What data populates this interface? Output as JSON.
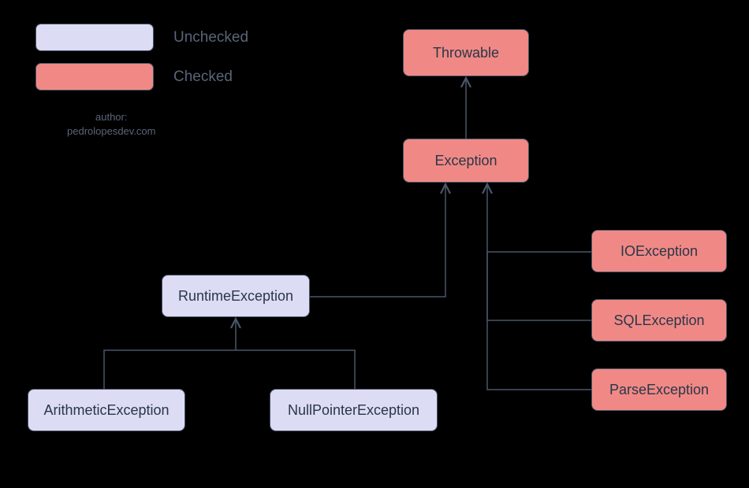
{
  "legend": {
    "unchecked_label": "Unchecked",
    "checked_label": "Checked"
  },
  "author": {
    "line1": "author:",
    "line2": "pedrolopesdev.com"
  },
  "nodes": {
    "throwable": "Throwable",
    "exception": "Exception",
    "runtime_exception": "RuntimeException",
    "arithmetic_exception": "ArithmeticException",
    "nullpointer_exception": "NullPointerException",
    "io_exception": "IOException",
    "sql_exception": "SQLException",
    "parse_exception": "ParseException"
  },
  "chart_data": {
    "type": "class-hierarchy",
    "title": "Java Exception Hierarchy",
    "legend": [
      {
        "category": "Unchecked",
        "color": "#dcdcf5"
      },
      {
        "category": "Checked",
        "color": "#f08986"
      }
    ],
    "nodes": [
      {
        "id": "Throwable",
        "category": "Checked"
      },
      {
        "id": "Exception",
        "category": "Checked",
        "parent": "Throwable"
      },
      {
        "id": "RuntimeException",
        "category": "Unchecked",
        "parent": "Exception"
      },
      {
        "id": "ArithmeticException",
        "category": "Unchecked",
        "parent": "RuntimeException"
      },
      {
        "id": "NullPointerException",
        "category": "Unchecked",
        "parent": "RuntimeException"
      },
      {
        "id": "IOException",
        "category": "Checked",
        "parent": "Exception"
      },
      {
        "id": "SQLException",
        "category": "Checked",
        "parent": "Exception"
      },
      {
        "id": "ParseException",
        "category": "Checked",
        "parent": "Exception"
      }
    ]
  }
}
